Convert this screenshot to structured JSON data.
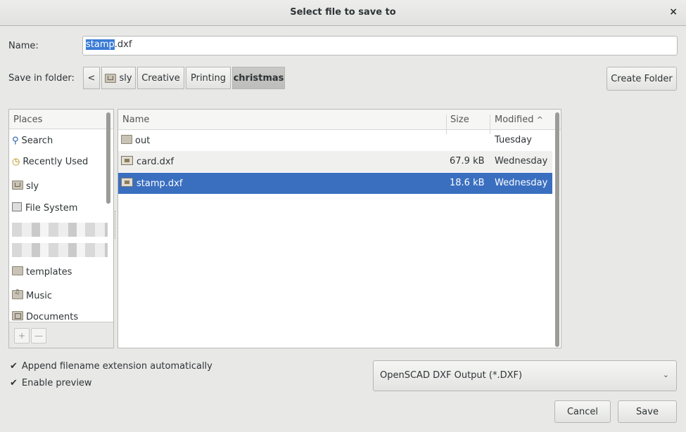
{
  "dialog": {
    "title": "Select file to save to",
    "close": "×"
  },
  "name_row": {
    "label": "Name:",
    "selected_part": "stamp",
    "rest": ".dxf"
  },
  "folder_row": {
    "label": "Save in folder:",
    "back": "<",
    "crumbs": [
      "sly",
      "Creative",
      "Printing",
      "christmas"
    ],
    "create_folder": "Create Folder"
  },
  "places": {
    "header": "Places",
    "items": [
      "Search",
      "Recently Used",
      "sly",
      "File System",
      "templates",
      "Music",
      "Documents"
    ],
    "add": "+",
    "remove": "—"
  },
  "files": {
    "headers": {
      "name": "Name",
      "size": "Size",
      "modified": "Modified",
      "sort_indicator": "^"
    },
    "rows": [
      {
        "name": "out",
        "size": "",
        "modified": "Tuesday"
      },
      {
        "name": "card.dxf",
        "size": "67.9 kB",
        "modified": "Wednesday"
      },
      {
        "name": "stamp.dxf",
        "size": "18.6 kB",
        "modified": "Wednesday"
      }
    ]
  },
  "options": {
    "append_ext": "Append filename extension automatically",
    "enable_preview": "Enable preview",
    "check": "✔"
  },
  "filter": {
    "value": "OpenSCAD DXF Output (*.DXF)",
    "chevron": "⌄"
  },
  "actions": {
    "cancel": "Cancel",
    "save": "Save"
  }
}
